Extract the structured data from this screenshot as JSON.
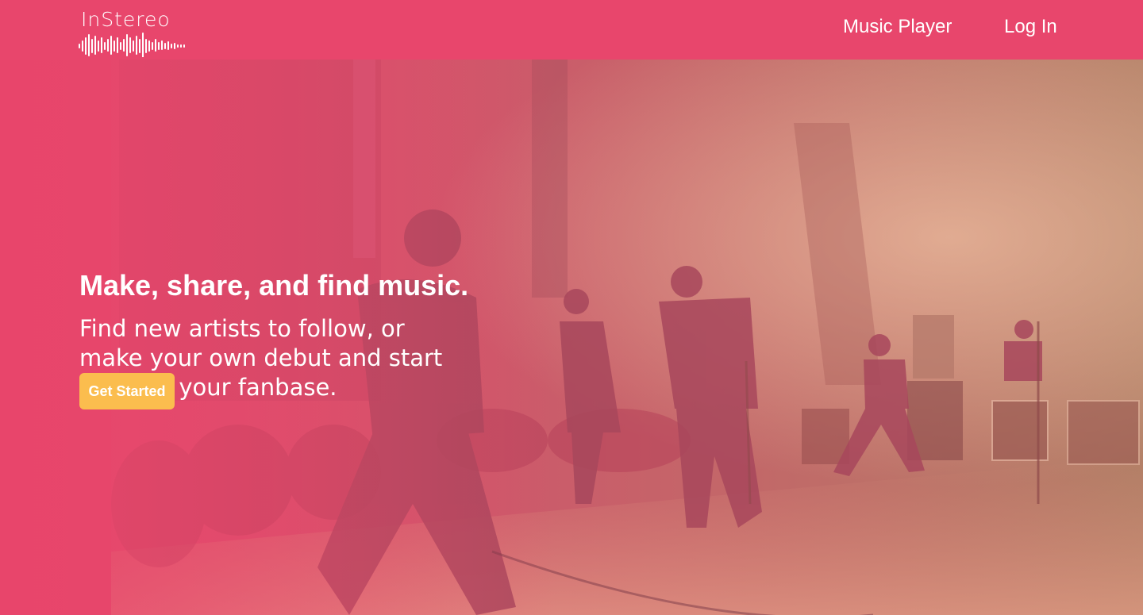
{
  "nav": {
    "logo_text": "InStereo",
    "links": [
      "Music Player",
      "Log In"
    ]
  },
  "hero": {
    "title": "Make, share, and find music.",
    "subtitle": "Find new artists to follow, or make your own debut and start building your fanbase.",
    "cta_label": "Get Started",
    "image": "concert-stage-photo"
  },
  "colors": {
    "brand_pink": "#e8466c",
    "cta_yellow": "#fbbd4e",
    "overlay_warm": "#b8735d"
  }
}
